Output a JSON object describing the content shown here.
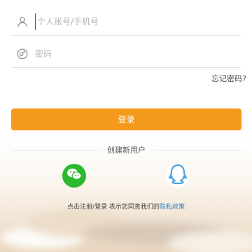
{
  "login": {
    "account_placeholder": "个人账号/手机号",
    "password_placeholder": "密码",
    "forgot_password": "忘记密码?",
    "login_button": "登录",
    "create_account": "创建新用户",
    "agreement_prefix": "点击注册/登录 表示您同意我们的",
    "privacy_link": "隐私政策"
  },
  "icons": {
    "account": "user-icon",
    "password": "lock-icon",
    "wechat": "wechat-icon",
    "qq": "qq-icon"
  },
  "colors": {
    "accent": "#f39a1c",
    "wechat": "#2bb92d",
    "qq": "#4aa3df",
    "link": "#2a7fd4"
  }
}
